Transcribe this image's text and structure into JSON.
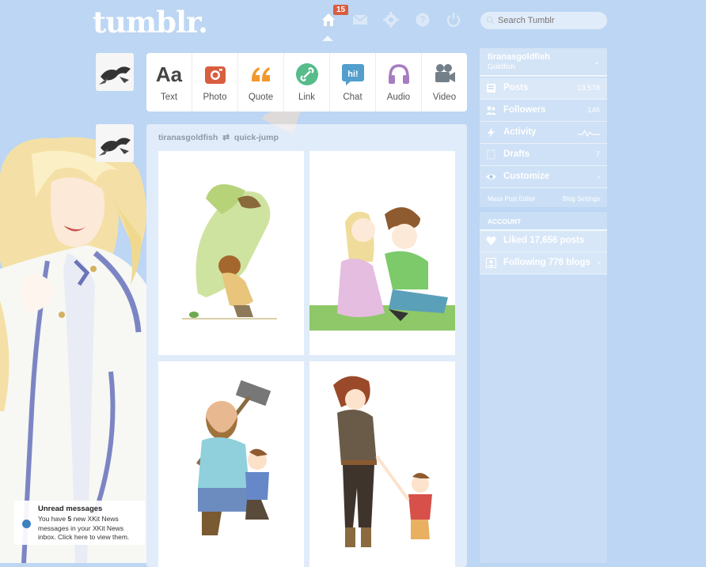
{
  "header": {
    "logo": "tumblr.",
    "badge_count": "15",
    "search_placeholder": "Search Tumblr",
    "icons": [
      "home-icon",
      "mail-icon",
      "gear-icon",
      "help-icon",
      "power-icon"
    ]
  },
  "post_types": [
    {
      "label": "Text",
      "glyph": "Aa",
      "icon": "text-icon",
      "color": "#444444"
    },
    {
      "label": "Photo",
      "icon": "camera-icon",
      "color": "#d95e40"
    },
    {
      "label": "Quote",
      "icon": "quote-icon",
      "color": "#f2992e"
    },
    {
      "label": "Link",
      "icon": "link-icon",
      "color": "#56bc8a"
    },
    {
      "label": "Chat",
      "glyph": "hi!",
      "icon": "chat-icon",
      "color": "#529ecc"
    },
    {
      "label": "Audio",
      "icon": "headphones-icon",
      "color": "#a77dc2"
    },
    {
      "label": "Video",
      "icon": "video-camera-icon",
      "color": "#748089"
    }
  ],
  "post": {
    "author": "tiranasgoldfish",
    "reblogged_from": "quick-jump"
  },
  "sidebar": {
    "blog_name": "tiranasgoldfish",
    "blog_title": "Goldfish",
    "items": [
      {
        "label": "Posts",
        "count": "13,578",
        "icon": "posts-icon"
      },
      {
        "label": "Followers",
        "count": "146",
        "icon": "followers-icon"
      },
      {
        "label": "Activity",
        "count": "",
        "icon": "activity-icon"
      },
      {
        "label": "Drafts",
        "count": "7",
        "icon": "drafts-icon"
      },
      {
        "label": "Customize",
        "count": "",
        "icon": "customize-icon"
      }
    ],
    "mass_post_editor": "Mass Post Editor",
    "blog_settings": "Blog Settings",
    "account_header": "ACCOUNT",
    "liked": "Liked 17,656 posts",
    "following": "Following 778 blogs"
  },
  "notification": {
    "title": "Unread messages",
    "body_pre": "You have ",
    "count": "5",
    "body_post": " new XKit News messages in your XKit News inbox. Click here to view them."
  },
  "colors": {
    "background": "#bcd6f3",
    "badge": "#d95e40",
    "accent_blue": "#529ecc"
  }
}
